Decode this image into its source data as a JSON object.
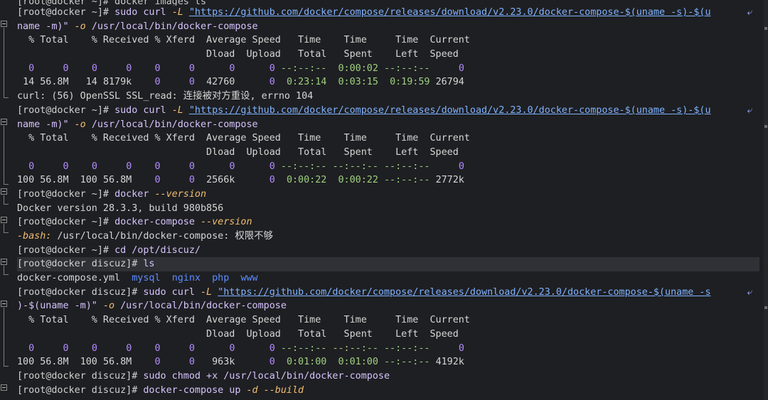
{
  "terminal": {
    "lines": [
      {
        "text": "[root@docker ~]# docker images ls"
      },
      {
        "prompt": "[root@docker ~]# ",
        "cmd": "sudo curl ",
        "opt": "-L ",
        "url": "\"https://github.com/docker/compose/releases/download/v2.23.0/docker-compose-$(uname -s)-$(u",
        "wrap": "⤶"
      },
      {
        "text2": "name -m)\" ",
        "opt2": "-o ",
        "tail": "/usr/local/bin/docker-compose"
      },
      {
        "text": "  % Total    % Received % Xferd  Average Speed   Time    Time     Time  Current"
      },
      {
        "text": "                                 Dload  Upload   Total   Spent    Left  Speed"
      },
      {
        "text": "  0     0    0     0    0     0      0      0 --:--:--  0:00:02 --:--:--     0"
      },
      {
        "text": " 14 56.8M   14 8179k    0     0  42760      0  0:23:14  0:03:15  0:19:59 26794"
      },
      {
        "text": "curl: (56) OpenSSL SSL_read: 连接被对方重设, errno 104"
      },
      {
        "prompt": "[root@docker ~]# ",
        "cmd": "sudo curl ",
        "opt": "-L ",
        "url": "\"https://github.com/docker/compose/releases/download/v2.23.0/docker-compose-$(uname -s)-$(u",
        "wrap": "⤶"
      },
      {
        "text2": "name -m)\" ",
        "opt2": "-o ",
        "tail": "/usr/local/bin/docker-compose"
      },
      {
        "text": "  % Total    % Received % Xferd  Average Speed   Time    Time     Time  Current"
      },
      {
        "text": "                                 Dload  Upload   Total   Spent    Left  Speed"
      },
      {
        "text": "  0     0    0     0    0     0      0      0 --:--:-- --:--:-- --:--:--     0"
      },
      {
        "text": "100 56.8M  100 56.8M    0     0  2566k      0  0:00:22  0:00:22 --:--:-- 2772k"
      },
      {
        "prompt": "[root@docker ~]# ",
        "cmd": "docker ",
        "opt": "--version"
      },
      {
        "text": "Docker version 28.3.3, build 980b856"
      },
      {
        "prompt": "[root@docker ~]# ",
        "cmd": "docker-compose ",
        "opt": "--version"
      },
      {
        "err": "-bash:",
        "tail": " /usr/local/bin/docker-compose: 权限不够"
      },
      {
        "prompt": "[root@docker ~]# ",
        "cmd": "cd /opt/discuz/"
      },
      {
        "prompt": "[root@docker discuz]# ",
        "cmd": "ls",
        "hl": true
      },
      {
        "files": [
          "docker-compose.yml",
          "mysql",
          "nginx",
          "php",
          "www"
        ]
      },
      {
        "prompt": "[root@docker discuz]# ",
        "cmd": "sudo curl ",
        "opt": "-L ",
        "url": "\"https://github.com/docker/compose/releases/download/v2.23.0/docker-compose-$(uname -s",
        "wrap": "⤶"
      },
      {
        "text2": ")-$(uname -m)\" ",
        "opt2": "-o ",
        "tail": "/usr/local/bin/docker-compose"
      },
      {
        "text": "  % Total    % Received % Xferd  Average Speed   Time    Time     Time  Current"
      },
      {
        "text": "                                 Dload  Upload   Total   Spent    Left  Speed"
      },
      {
        "text": "  0     0    0     0    0     0      0      0 --:--:-- --:--:-- --:--:--     0"
      },
      {
        "text": "100 56.8M  100 56.8M    0     0   963k      0  0:01:00  0:01:00 --:--:-- 4192k"
      },
      {
        "prompt": "[root@docker discuz]# ",
        "cmd": "sudo chmod +x /usr/local/bin/docker-compose"
      },
      {
        "prompt": "[root@docker discuz]# ",
        "cmd": "docker-compose up ",
        "opt": "-d --build"
      }
    ]
  }
}
